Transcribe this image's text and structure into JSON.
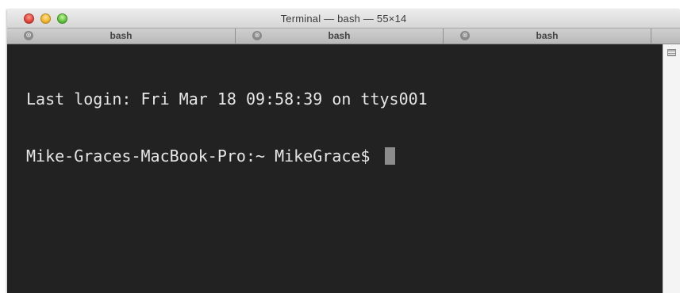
{
  "window": {
    "title": "Terminal — bash — 55×14"
  },
  "tabs": [
    {
      "label": "bash"
    },
    {
      "label": "bash"
    },
    {
      "label": "bash"
    }
  ],
  "icons": {
    "tab_close": "⊗",
    "traffic_close": "close-icon",
    "traffic_minimize": "minimize-icon",
    "traffic_zoom": "zoom-icon",
    "split_pane": "split-pane-icon"
  },
  "terminal": {
    "lines": [
      "Last login: Fri Mar 18 09:58:39 on ttys001",
      "Mike-Graces-MacBook-Pro:~ MikeGrace$ "
    ]
  },
  "colors": {
    "terminal_background": "#222222",
    "terminal_text": "#e6e6e6",
    "cursor": "#8c8c8c"
  }
}
